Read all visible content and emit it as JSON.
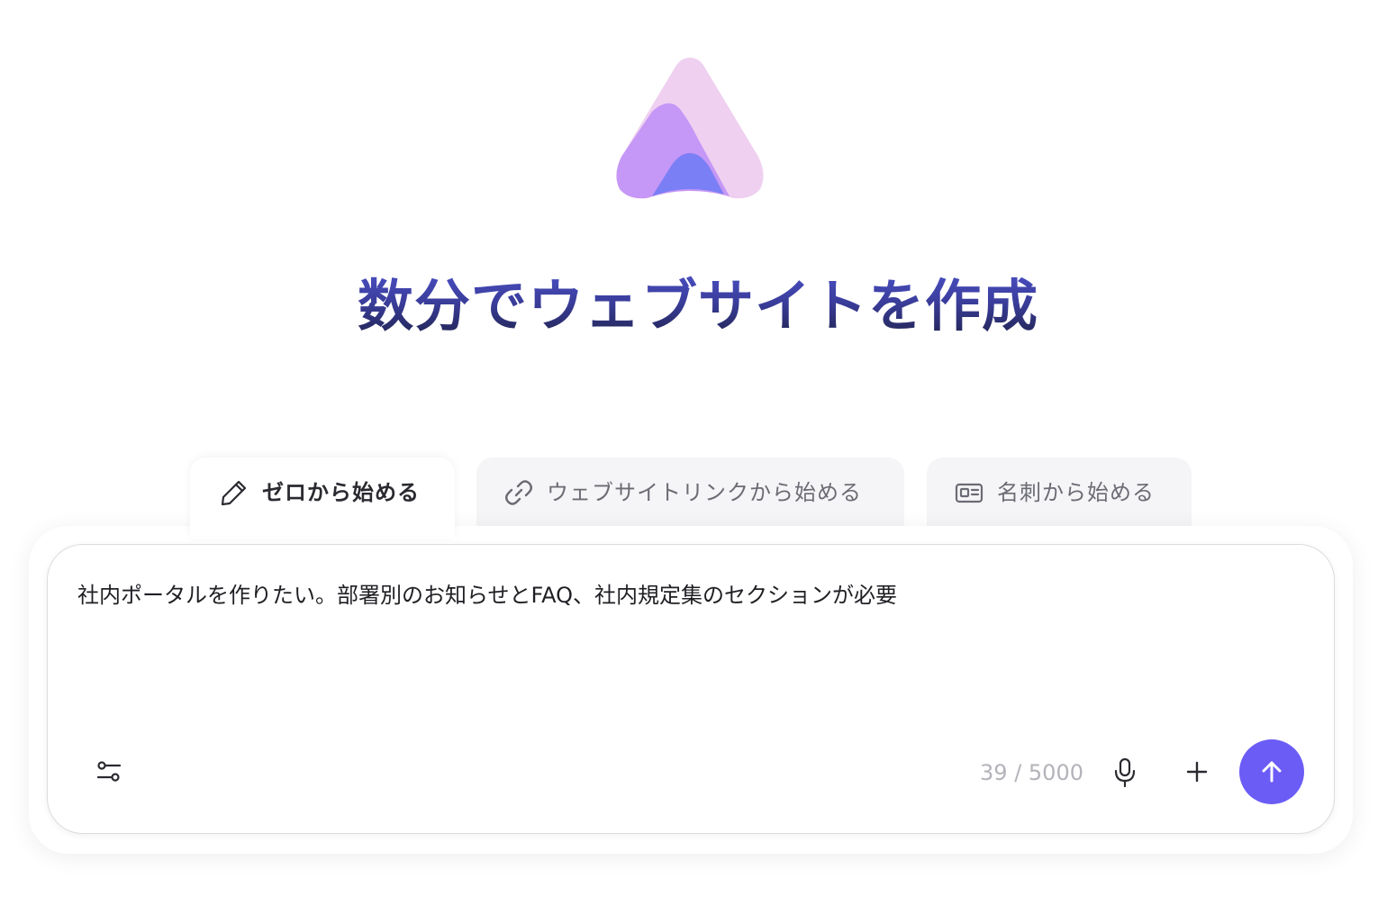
{
  "headline": "数分でウェブサイトを作成",
  "tabs": [
    {
      "label": "ゼロから始める",
      "icon": "pencil-icon",
      "active": true
    },
    {
      "label": "ウェブサイトリンクから始める",
      "icon": "link-icon",
      "active": false
    },
    {
      "label": "名刺から始める",
      "icon": "id-card-icon",
      "active": false
    }
  ],
  "composer": {
    "text": "社内ポータルを作りたい。部署別のお知らせとFAQ、社内規定集のセクションが必要",
    "char_count": "39 / 5000",
    "settings_icon": "sliders-icon",
    "mic_icon": "microphone-icon",
    "plus_icon": "plus-icon",
    "send_icon": "arrow-up-icon"
  },
  "colors": {
    "accent": "#6b5cf6",
    "headline_top": "#4a4fc4",
    "headline_bottom": "#1e2148",
    "logo_pink": "#efd0f0",
    "logo_purple": "#c597f6",
    "logo_blue": "#7b7ff5"
  }
}
